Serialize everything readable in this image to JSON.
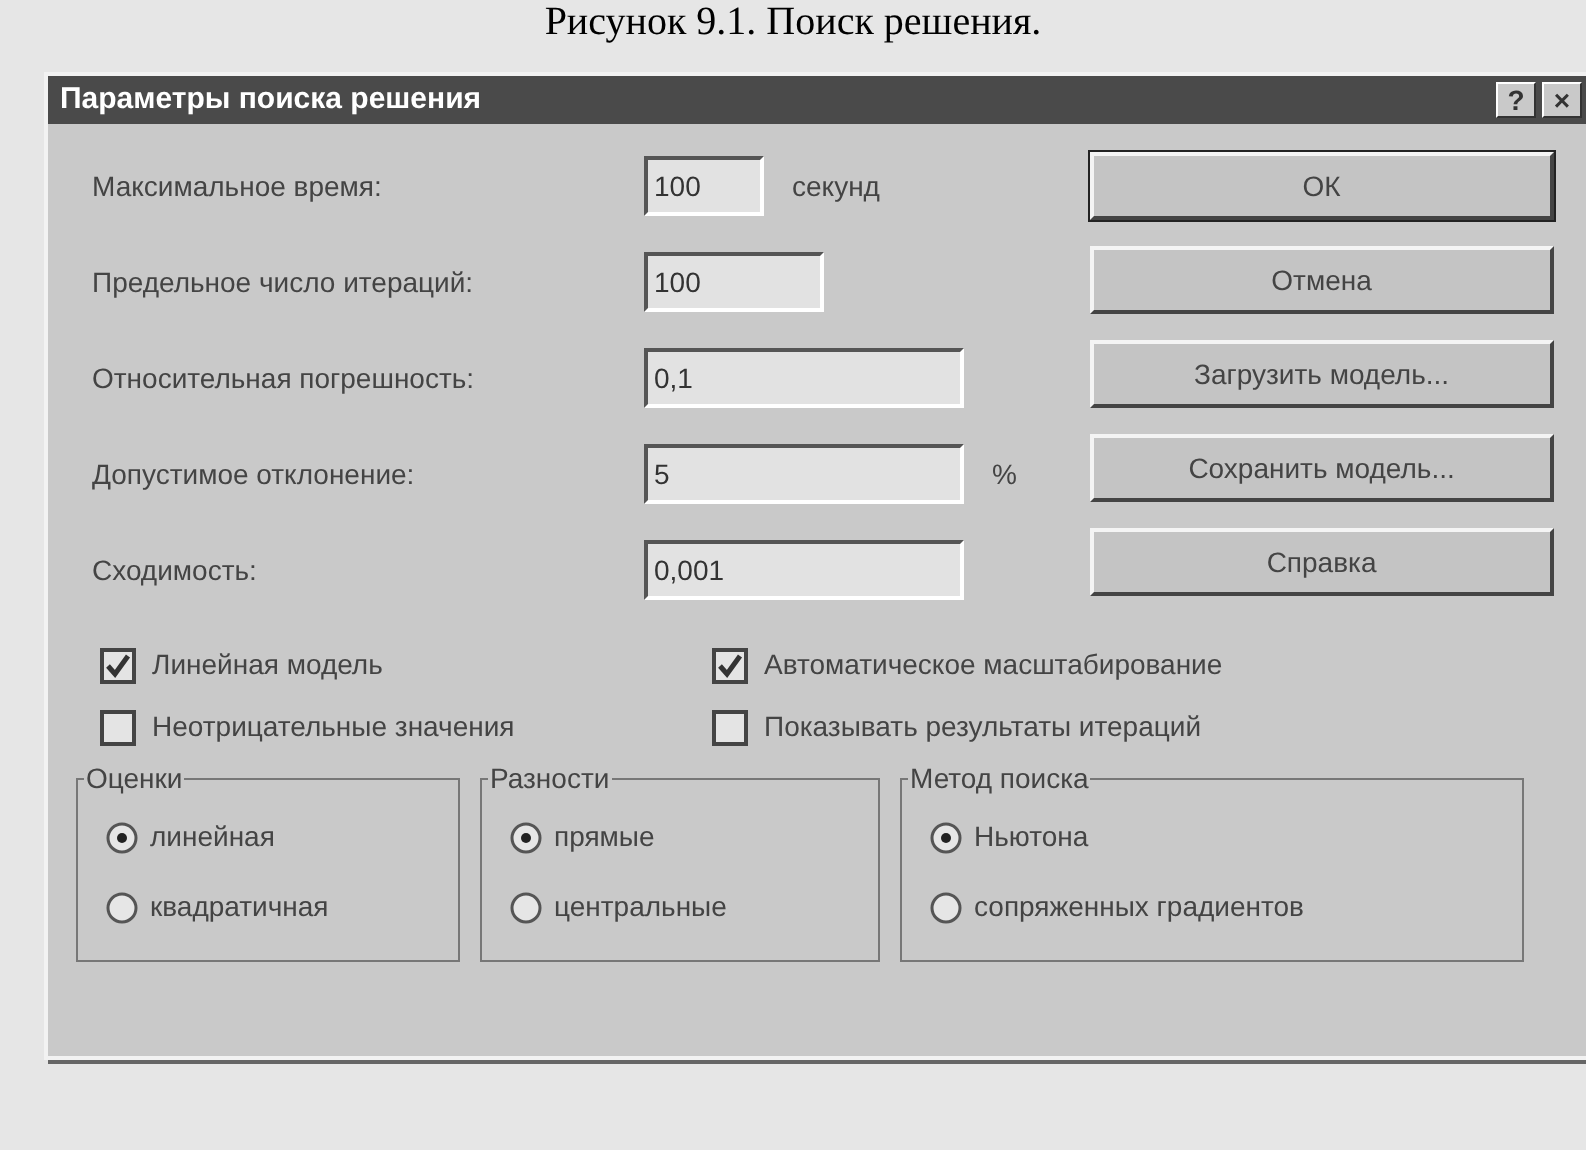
{
  "caption": "Рисунок 9.1. Поиск решения.",
  "window": {
    "title": "Параметры поиска решения",
    "title_buttons": [
      "?",
      "×"
    ]
  },
  "fields": [
    {
      "label": "Максимальное время:",
      "value": "100",
      "unit": "секунд"
    },
    {
      "label": "Предельное число итераций:",
      "value": "100"
    },
    {
      "label": "Относительная погрешность:",
      "value": "0,1"
    },
    {
      "label": "Допустимое отклонение:",
      "value": "5",
      "unit": "%"
    },
    {
      "label": "Сходимость:",
      "value": "0,001"
    }
  ],
  "buttons": [
    {
      "label": "ОК",
      "default": true
    },
    {
      "label": "Отмена",
      "default": false
    },
    {
      "label": "Загрузить модель...",
      "default": false
    },
    {
      "label": "Сохранить модель...",
      "default": false
    },
    {
      "label": "Справка",
      "default": false
    }
  ],
  "checkboxes": [
    {
      "label": "Линейная модель",
      "checked": true
    },
    {
      "label": "Автоматическое масштабирование",
      "checked": true
    },
    {
      "label": "Неотрицательные значения",
      "checked": false
    },
    {
      "label": "Показывать результаты итераций",
      "checked": false
    }
  ],
  "groups": [
    {
      "title": "Оценки",
      "options": [
        {
          "label": "линейная",
          "selected": true
        },
        {
          "label": "квадратичная",
          "selected": false
        }
      ]
    },
    {
      "title": "Разности",
      "options": [
        {
          "label": "прямые",
          "selected": true
        },
        {
          "label": "центральные",
          "selected": false
        }
      ]
    },
    {
      "title": "Метод поиска",
      "options": [
        {
          "label": "Ньютона",
          "selected": true
        },
        {
          "label": "сопряженных градиентов",
          "selected": false
        }
      ]
    }
  ]
}
